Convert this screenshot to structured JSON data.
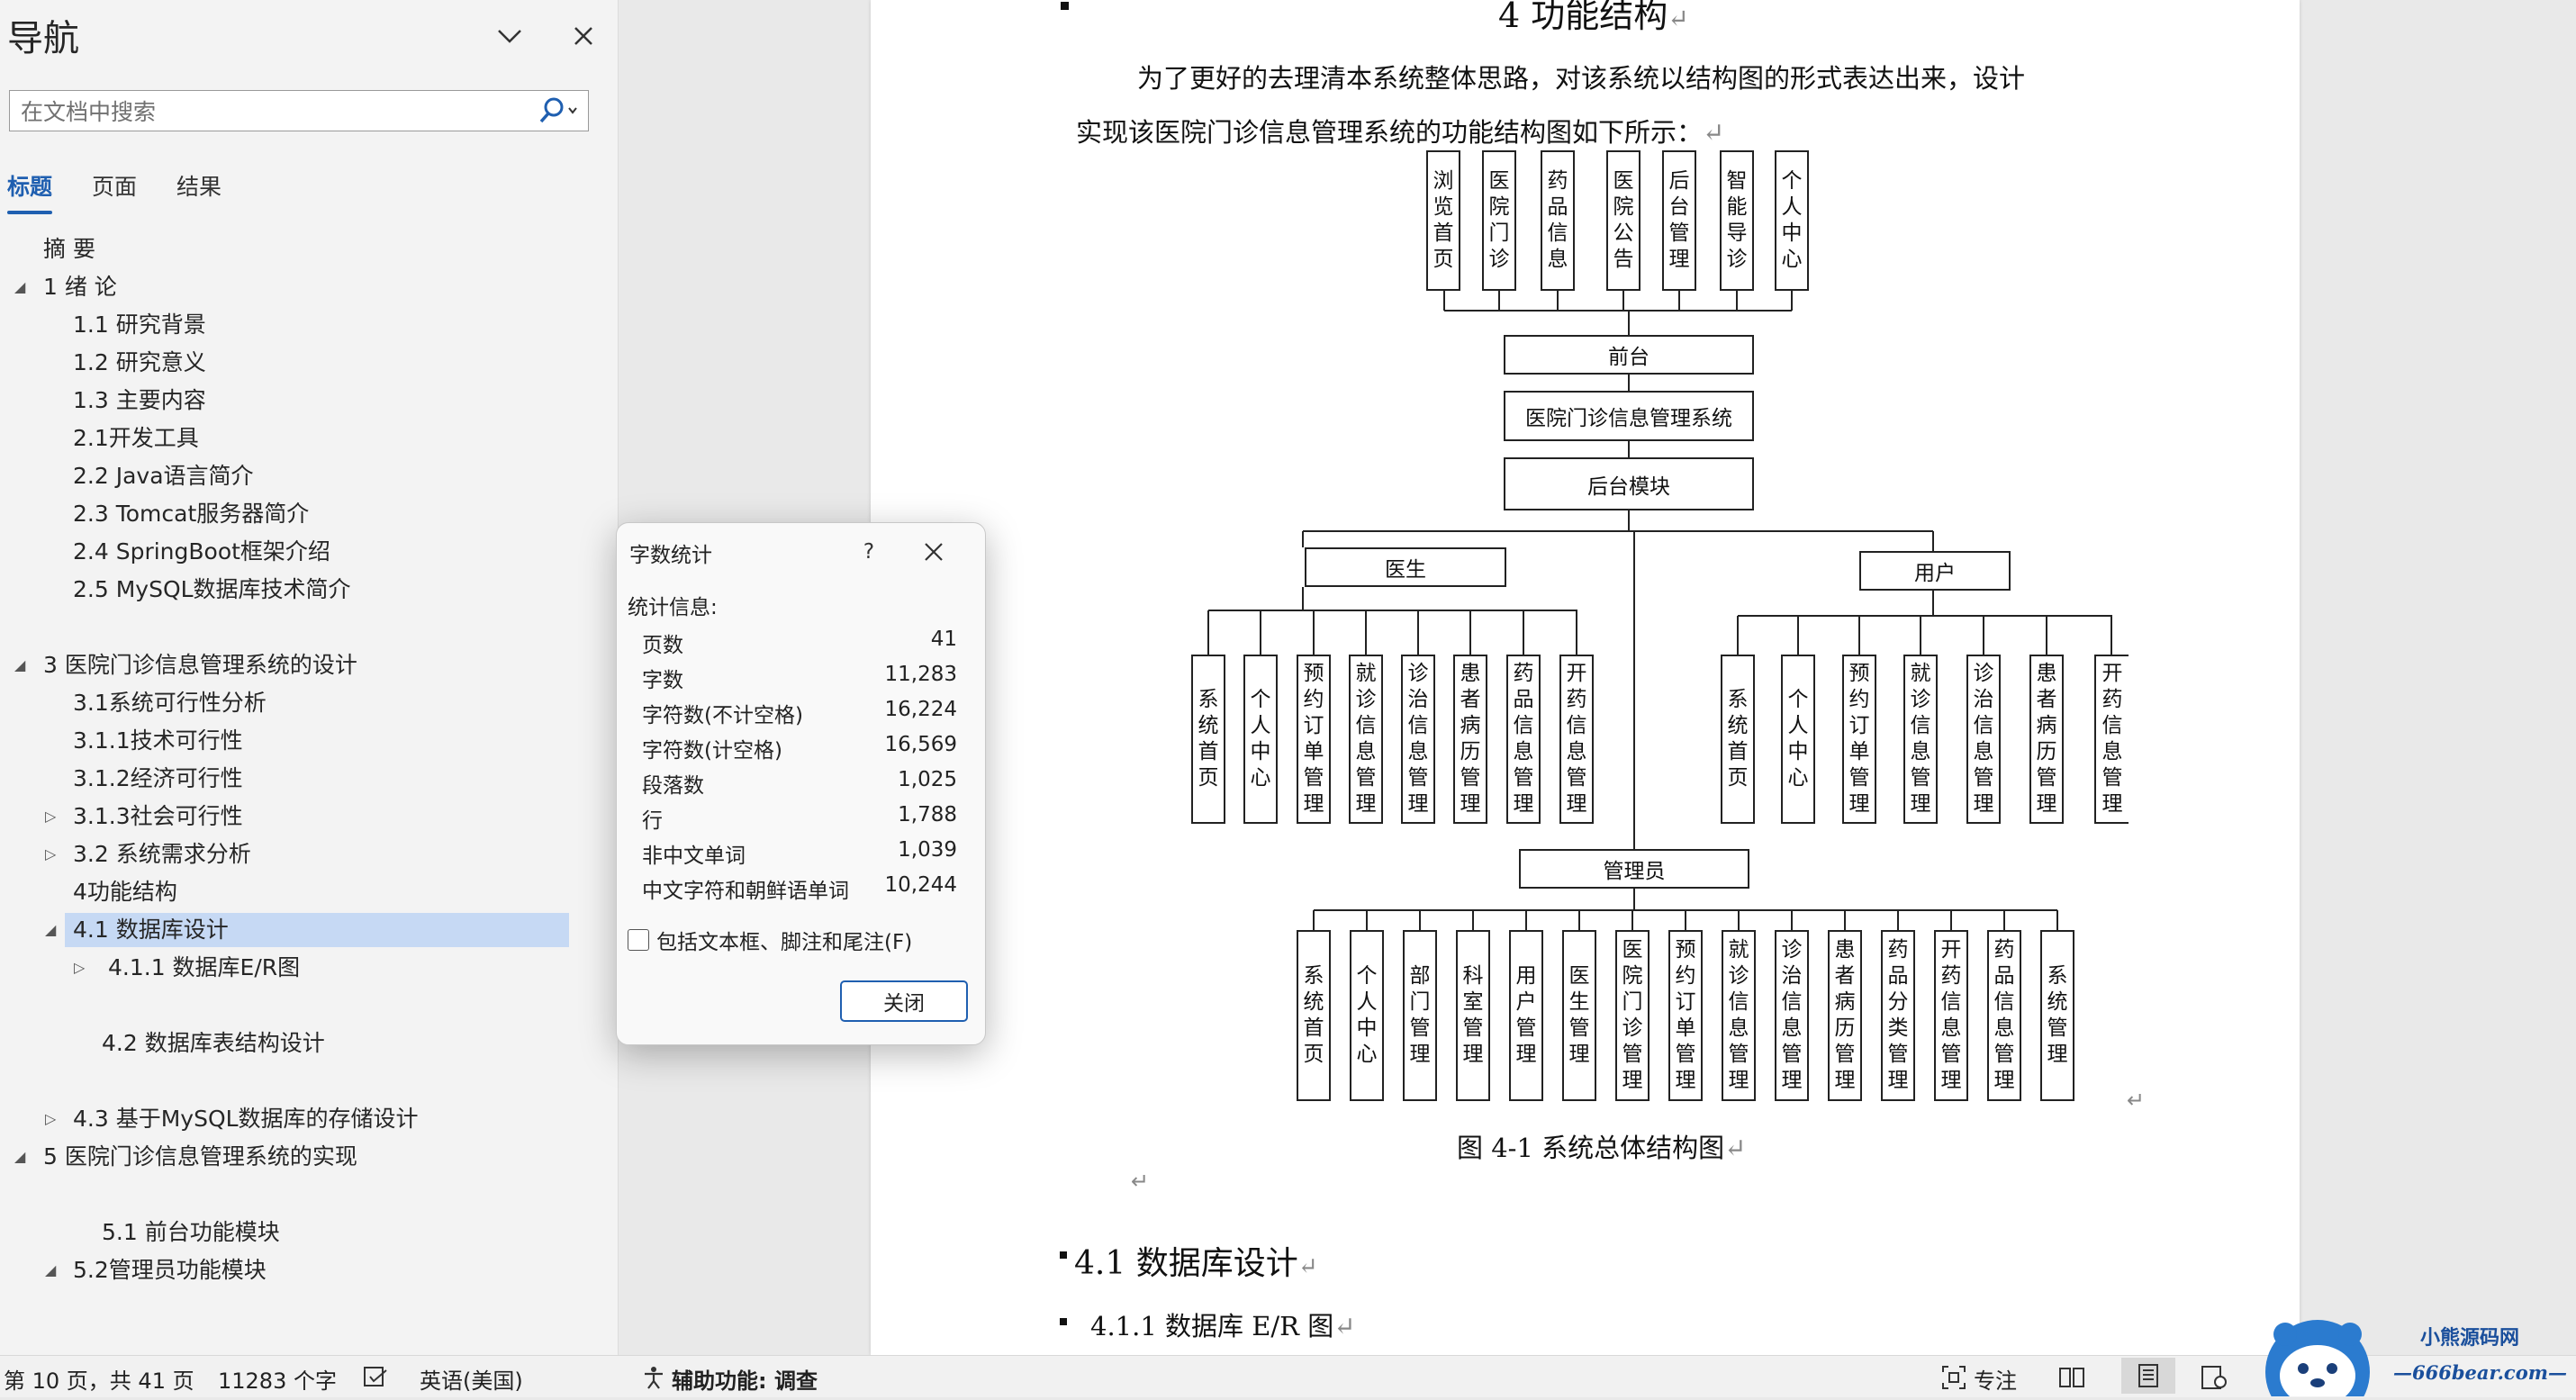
{
  "nav": {
    "title": "导航",
    "search_placeholder": "在文档中搜索",
    "tabs": [
      "标题",
      "页面",
      "结果"
    ],
    "items": [
      "摘  要",
      "1 绪  论",
      "1.1 研究背景",
      "1.2 研究意义",
      "1.3 主要内容",
      "2.1开发工具",
      "2.2 Java语言简介",
      "2.3 Tomcat服务器简介",
      "2.4 SpringBoot框架介绍",
      "2.5 MySQL数据库技术简介",
      "3 医院门诊信息管理系统的设计",
      "3.1系统可行性分析",
      "3.1.1技术可行性",
      "3.1.2经济可行性",
      "3.1.3社会可行性",
      "3.2 系统需求分析",
      "4功能结构",
      "4.1 数据库设计",
      "4.1.1 数据库E/R图",
      "4.2 数据库表结构设计",
      "4.3 基于MySQL数据库的存储设计",
      "5 医院门诊信息管理系统的实现",
      "5.1 前台功能模块",
      "5.2管理员功能模块"
    ]
  },
  "document": {
    "heading": "4 功能结构",
    "para_line1": "为了更好的去理清本系统整体思路，对该系统以结构图的形式表达出来，设计",
    "para_line2": "实现该医院门诊信息管理系统的功能结构图如下所示：",
    "figure_caption": "图 4-1  系统总体结构图",
    "section_41": "4.1  数据库设计",
    "section_411": "4.1.1  数据库 E/R 图",
    "para_mark": "↵",
    "org": {
      "top_items": [
        "浏览首页",
        "医院门诊",
        "药品信息",
        "医院公告",
        "后台管理",
        "智能导诊",
        "个人中心"
      ],
      "frontend": "前台",
      "system": "医院门诊信息管理系统",
      "backend": "后台模块",
      "doctor": "医生",
      "doctor_items": [
        "系统首页",
        "个人中心",
        "预约订单管理",
        "就诊信息管理",
        "诊治信息管理",
        "患者病历管理",
        "药品信息管理",
        "开药信息管理"
      ],
      "user": "用户",
      "user_items": [
        "系统首页",
        "个人中心",
        "预约订单管理",
        "就诊信息管理",
        "诊治信息管理",
        "患者病历管理",
        "开药信息管理"
      ],
      "admin": "管理员",
      "admin_items": [
        "系统首页",
        "个人中心",
        "部门管理",
        "科室管理",
        "用户管理",
        "医生管理",
        "医院门诊管理",
        "预约订单管理",
        "就诊信息管理",
        "诊治信息管理",
        "患者病历管理",
        "药品分类管理",
        "开药信息管理",
        "药品信息管理",
        "系统管理"
      ]
    }
  },
  "dialog": {
    "title": "字数统计",
    "help": "?",
    "subtitle": "统计信息:",
    "stats": [
      {
        "label": "页数",
        "value": "41"
      },
      {
        "label": "字数",
        "value": "11,283"
      },
      {
        "label": "字符数(不计空格)",
        "value": "16,224"
      },
      {
        "label": "字符数(计空格)",
        "value": "16,569"
      },
      {
        "label": "段落数",
        "value": "1,025"
      },
      {
        "label": "行",
        "value": "1,788"
      },
      {
        "label": "非中文单词",
        "value": "1,039"
      },
      {
        "label": "中文字符和朝鲜语单词",
        "value": "10,244"
      }
    ],
    "checkbox_label": "包括文本框、脚注和尾注(F)",
    "close_label": "关闭"
  },
  "status": {
    "page": "第 10 页，共 41 页",
    "words": "11283 个字",
    "language": "英语(美国)",
    "accessibility": "辅助功能: 调查",
    "focus": "专注"
  },
  "watermark": {
    "line1": "小熊源码网",
    "line2": "—666bear.com—"
  },
  "colors": {
    "accent": "#1f5fb0",
    "selection": "#c6d9f4",
    "nav_bg": "#f3f3f3",
    "workspace_bg": "#e9e9e9"
  }
}
